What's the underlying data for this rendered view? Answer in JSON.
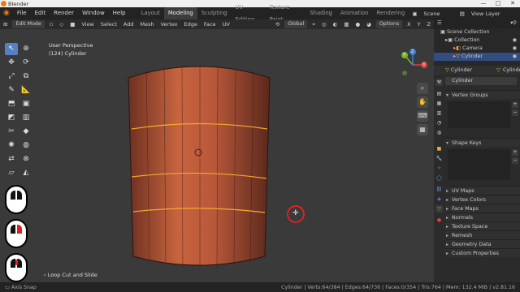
{
  "app": {
    "title": "Blender"
  },
  "window_controls": {
    "minimize": "—",
    "maximize": "□",
    "close": "✕"
  },
  "menu": {
    "items": [
      "File",
      "Edit",
      "Render",
      "Window",
      "Help"
    ],
    "workspaces": [
      "Layout",
      "Modeling",
      "Sculpting",
      "UV Editing",
      "Texture Paint",
      "Shading",
      "Animation",
      "Rendering"
    ],
    "active_workspace": "Modeling",
    "scene": "Scene",
    "view_layer": "View Layer"
  },
  "header": {
    "mode": "Edit Mode",
    "menus": [
      "View",
      "Select",
      "Add",
      "Mesh",
      "Vertex",
      "Edge",
      "Face",
      "UV"
    ],
    "transform": "Global",
    "options": "Options",
    "axes": [
      "X",
      "Y",
      "Z"
    ]
  },
  "viewport": {
    "perspective": "User Perspective",
    "object_label": "(124) Cylinder",
    "axis_x": "X",
    "axis_y": "Y",
    "axis_z": "Z",
    "operator_panel": "Loop Cut and Slide"
  },
  "outliner": {
    "root": "Scene Collection",
    "collection": "Collection",
    "items": [
      "Camera",
      "Cylinder"
    ],
    "selected": "Cylinder"
  },
  "properties": {
    "object": "Cylinder",
    "data_tab": "Cylinde",
    "data_name": "Cylinder",
    "panels_open": [
      "Vertex Groups",
      "Shape Keys"
    ],
    "panels_closed": [
      "UV Maps",
      "Vertex Colors",
      "Face Maps",
      "Normals",
      "Texture Space",
      "Remesh",
      "Geometry Data",
      "Custom Properties"
    ]
  },
  "status": {
    "left": "Axis Snap",
    "right": "Cylinder | Verts:64/384 | Edges:64/736 | Faces:0/354 | Tris:764 | Mem: 132.4 MiB | v2.81.16"
  },
  "colors": {
    "accent": "#5680c2",
    "cylinder": "#b5573a",
    "selection_ring": "#e02020",
    "blender_orange": "#e87d0d"
  }
}
